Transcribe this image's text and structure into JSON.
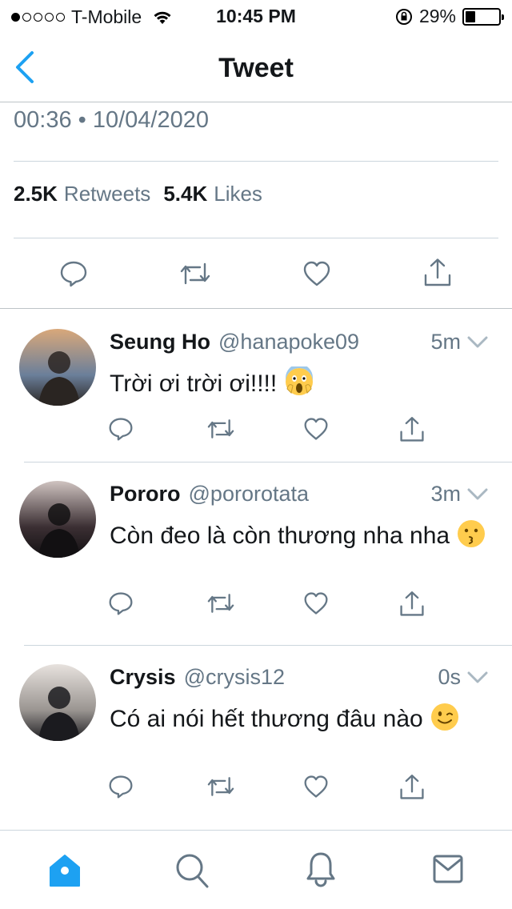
{
  "status_bar": {
    "carrier": "T-Mobile",
    "time": "10:45 PM",
    "battery_percent": "29%",
    "battery_level": 0.29,
    "signal_bars_filled": 1,
    "signal_bars_total": 5
  },
  "nav": {
    "title": "Tweet",
    "back_icon": "chevron-left-icon"
  },
  "tweet": {
    "timestamp": "00:36 • 10/04/2020",
    "retweets_count": "2.5K",
    "retweets_label": "Retweets",
    "likes_count": "5.4K",
    "likes_label": "Likes"
  },
  "colors": {
    "accent": "#1da1f2",
    "secondary_text": "#657786",
    "icon_gray": "#657786"
  },
  "replies": [
    {
      "name": "Seung Ho",
      "handle": "@hanapoke09",
      "time": "5m",
      "text": "Trời ơi trời ơi!!!!",
      "emoji": "screaming-face-emoji"
    },
    {
      "name": "Pororo",
      "handle": "@pororotata",
      "time": "3m",
      "text": "Còn đeo là còn thương nha nha",
      "emoji": "kissing-face-emoji"
    },
    {
      "name": "Crysis",
      "handle": "@crysis12",
      "time": "0s",
      "text": "Có ai nói hết thương đâu nào",
      "emoji": "winking-face-emoji"
    }
  ],
  "tab_bar": {
    "tabs": [
      "home-icon",
      "search-icon",
      "bell-icon",
      "mail-icon"
    ],
    "active": "home-icon"
  }
}
